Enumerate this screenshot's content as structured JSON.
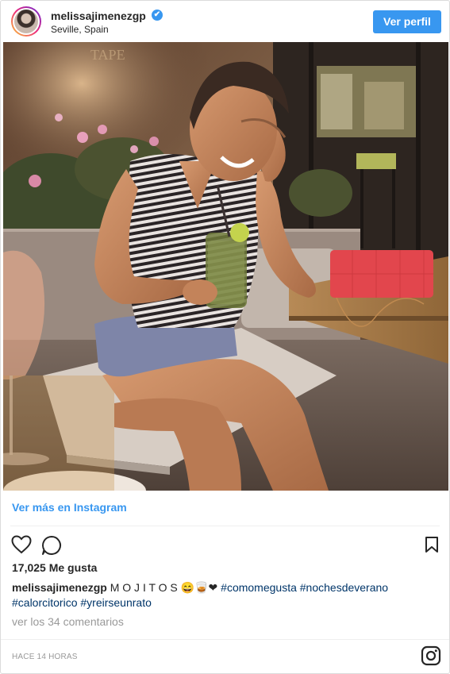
{
  "header": {
    "username": "melissajimenezgp",
    "verified_mark": "✔",
    "location": "Seville, Spain",
    "profile_button": "Ver perfil"
  },
  "photo": {
    "bar_sign": "TAPE",
    "colors": {
      "bag": "#e2464d",
      "shirt_stripe": "#2a2426",
      "skin": "#c88a63"
    }
  },
  "links": {
    "see_more": "Ver más en Instagram"
  },
  "actions": {
    "like_icon": "heart-icon",
    "comment_icon": "comment-icon",
    "save_icon": "bookmark-icon"
  },
  "likes": "17,025 Me gusta",
  "caption": {
    "username": "melissajimenezgp",
    "text": "M O J I T O S",
    "emojis": "😄🥃❤",
    "hashtags": [
      "#comomegusta",
      "#nochesdeverano",
      "#calorcitorico",
      "#yreirseunrato"
    ]
  },
  "comments_link": "ver los 34 comentarios",
  "timestamp": "HACE 14 HORAS",
  "colors": {
    "accent": "#3897f0",
    "hashtag": "#003569",
    "muted": "#999999"
  }
}
